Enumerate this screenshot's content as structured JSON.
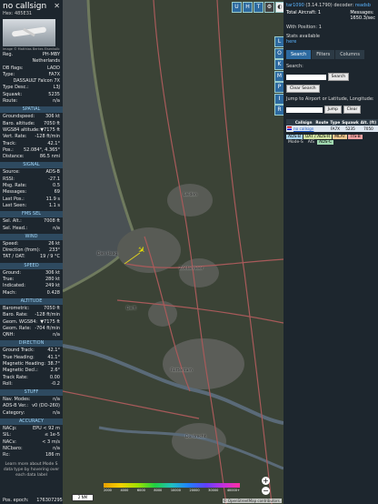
{
  "aircraft": {
    "title": "no callsign",
    "hex_label": "Hex:",
    "hex": "485E31",
    "image_credit": "Image © Matthias Berkes Eisenkolb",
    "close": "✕"
  },
  "info_rows": [
    {
      "k": "Reg.",
      "v": "PH-MBY"
    },
    {
      "k": "",
      "v": "Netherlands"
    },
    {
      "k": "DB flags:",
      "v": "LADD"
    },
    {
      "k": "Type:",
      "v": "FA7X"
    },
    {
      "k": "",
      "v": "DASSAULT Falcon 7X"
    },
    {
      "k": "Type Desc.:",
      "v": "L3J"
    },
    {
      "k": "Squawk:",
      "v": "5235"
    },
    {
      "k": "Route:",
      "v": "n/a"
    }
  ],
  "sections": [
    {
      "title": "SPATIAL",
      "rows": [
        {
          "k": "Groundspeed:",
          "v": "306 kt"
        },
        {
          "k": "Baro. altitude:",
          "v": "7050 ft"
        },
        {
          "k": "WGS84 altitude:",
          "v": "▼7175 ft"
        },
        {
          "k": "Vert. Rate:",
          "v": "-128 ft/min"
        },
        {
          "k": "Track:",
          "v": "42.1°"
        },
        {
          "k": "Pos.:",
          "v": "52.084°, 4.365°"
        },
        {
          "k": "Distance:",
          "v": "86.5 nmi"
        }
      ]
    },
    {
      "title": "SIGNAL",
      "rows": [
        {
          "k": "Source:",
          "v": "ADS-B"
        },
        {
          "k": "RSSI:",
          "v": "-27.1"
        },
        {
          "k": "Msg. Rate:",
          "v": "0.5"
        },
        {
          "k": "Messages:",
          "v": "69"
        },
        {
          "k": "Last Pos.:",
          "v": "11.9 s"
        },
        {
          "k": "Last Seen:",
          "v": "1.1 s"
        }
      ]
    },
    {
      "title": "FMS SEL",
      "rows": [
        {
          "k": "Sel. Alt.:",
          "v": "7008 ft"
        },
        {
          "k": "Sel. Head.:",
          "v": "n/a"
        }
      ]
    },
    {
      "title": "WIND",
      "rows": [
        {
          "k": "Speed:",
          "v": "26 kt"
        },
        {
          "k": "Direction (from):",
          "v": "233°"
        },
        {
          "k": "TAT / OAT:",
          "v": "19 / 9 °C"
        }
      ]
    },
    {
      "title": "SPEED",
      "rows": [
        {
          "k": "Ground:",
          "v": "306 kt"
        },
        {
          "k": "True:",
          "v": "280 kt"
        },
        {
          "k": "Indicated:",
          "v": "249 kt"
        },
        {
          "k": "Mach:",
          "v": "0.428"
        }
      ]
    },
    {
      "title": "ALTITUDE",
      "rows": [
        {
          "k": "Barometric:",
          "v": "7050 ft"
        },
        {
          "k": "Baro. Rate:",
          "v": "-128 ft/min"
        },
        {
          "k": "Geom. WGS84:",
          "v": "▼7175 ft"
        },
        {
          "k": "Geom. Rate:",
          "v": "-704 ft/min"
        },
        {
          "k": "QNH:",
          "v": "n/a"
        }
      ]
    },
    {
      "title": "DIRECTION",
      "rows": [
        {
          "k": "Ground Track:",
          "v": "42.1°"
        },
        {
          "k": "True Heading:",
          "v": "41.1°"
        },
        {
          "k": "Magnetic Heading:",
          "v": "38.7°"
        },
        {
          "k": "Magnetic Decl.:",
          "v": "2.6°"
        },
        {
          "k": "Track Rate:",
          "v": "0.00"
        },
        {
          "k": "Roll:",
          "v": "-0.2"
        }
      ]
    },
    {
      "title": "STUFF",
      "rows": [
        {
          "k": "Nav. Modes:",
          "v": "n/a"
        },
        {
          "k": "ADS-B Ver.:",
          "v": "v0 (DO-260)"
        },
        {
          "k": "Category:",
          "v": "n/a"
        }
      ]
    },
    {
      "title": "ACCURACY",
      "rows": [
        {
          "k": "NACp:",
          "v": "EPU < 92 m"
        },
        {
          "k": "SIL:",
          "v": "≤ 1e-5"
        },
        {
          "k": "NACv:",
          "v": "< 3 m/s"
        },
        {
          "k": "NICbaro:",
          "v": "n/a"
        },
        {
          "k": "Rc:",
          "v": "186 m"
        }
      ]
    }
  ],
  "learn_more": "Learn more about Mode S data type by hovering over each data label",
  "pos_epoch": {
    "k": "Pos. epoch:",
    "v": "1763072958"
  },
  "map": {
    "toolbar_top": [
      "U",
      "H",
      "T"
    ],
    "side_buttons": [
      "L",
      "O",
      "K",
      "M",
      "P",
      "I",
      "R"
    ],
    "cities": [
      "Leiden",
      "Den Haag",
      "Zoetermeer",
      "Delft",
      "Rotterdam",
      "Dordrecht"
    ],
    "zoom_in": "+",
    "zoom_out": "−",
    "scale_label": "2 NM",
    "altitude_ticks": [
      "2000",
      "4000",
      "6000",
      "8000",
      "10000",
      "20000",
      "30000",
      "40000+"
    ],
    "altitude_unit": "ft",
    "attribution": "© OpenStreetMap contributors."
  },
  "right_panel": {
    "version_link": "tar1090",
    "version": "(3.14.1790)",
    "decoder_label": "decoder:",
    "decoder": "readsb",
    "total_label": "Total Aircraft:",
    "total": "1",
    "messages_label": "Messages:",
    "messages": "1650.3/sec",
    "with_pos_label": "With Position:",
    "with_pos": "1",
    "stats_avail": "Stats available",
    "stats_link": "here",
    "tabs": [
      "Search",
      "Filters",
      "Columns"
    ],
    "search_label": "Search:",
    "search_button": "Search",
    "clear_search": "Clear Search",
    "jump_label": "Jump to Airport or Latitude, Longitude:",
    "jump_button": "Jump",
    "clear_button": "Clear",
    "table_headers": [
      "",
      "Callsign",
      "Route",
      "Type",
      "Squawk",
      "Alt. (ft)",
      "Sp"
    ],
    "table_row": {
      "flag": "",
      "callsign": "no callsign",
      "route": "",
      "type": "FA7X",
      "squawk": "5235",
      "alt": "7050",
      "speed": "30"
    },
    "sources": [
      {
        "label": "ADS-B",
        "color": "#a6d1e8"
      },
      {
        "label": "UAT / ADS-R",
        "color": "#cfe0a0"
      },
      {
        "label": "MLAT",
        "color": "#f0c890"
      },
      {
        "label": "TIS-B",
        "color": "#f0a0a0"
      }
    ],
    "sources2": [
      {
        "label": "Mode-S",
        "color": ""
      },
      {
        "label": "AIS",
        "color": ""
      },
      {
        "label": "ADS-C",
        "color": "#a0d8b0"
      }
    ]
  }
}
